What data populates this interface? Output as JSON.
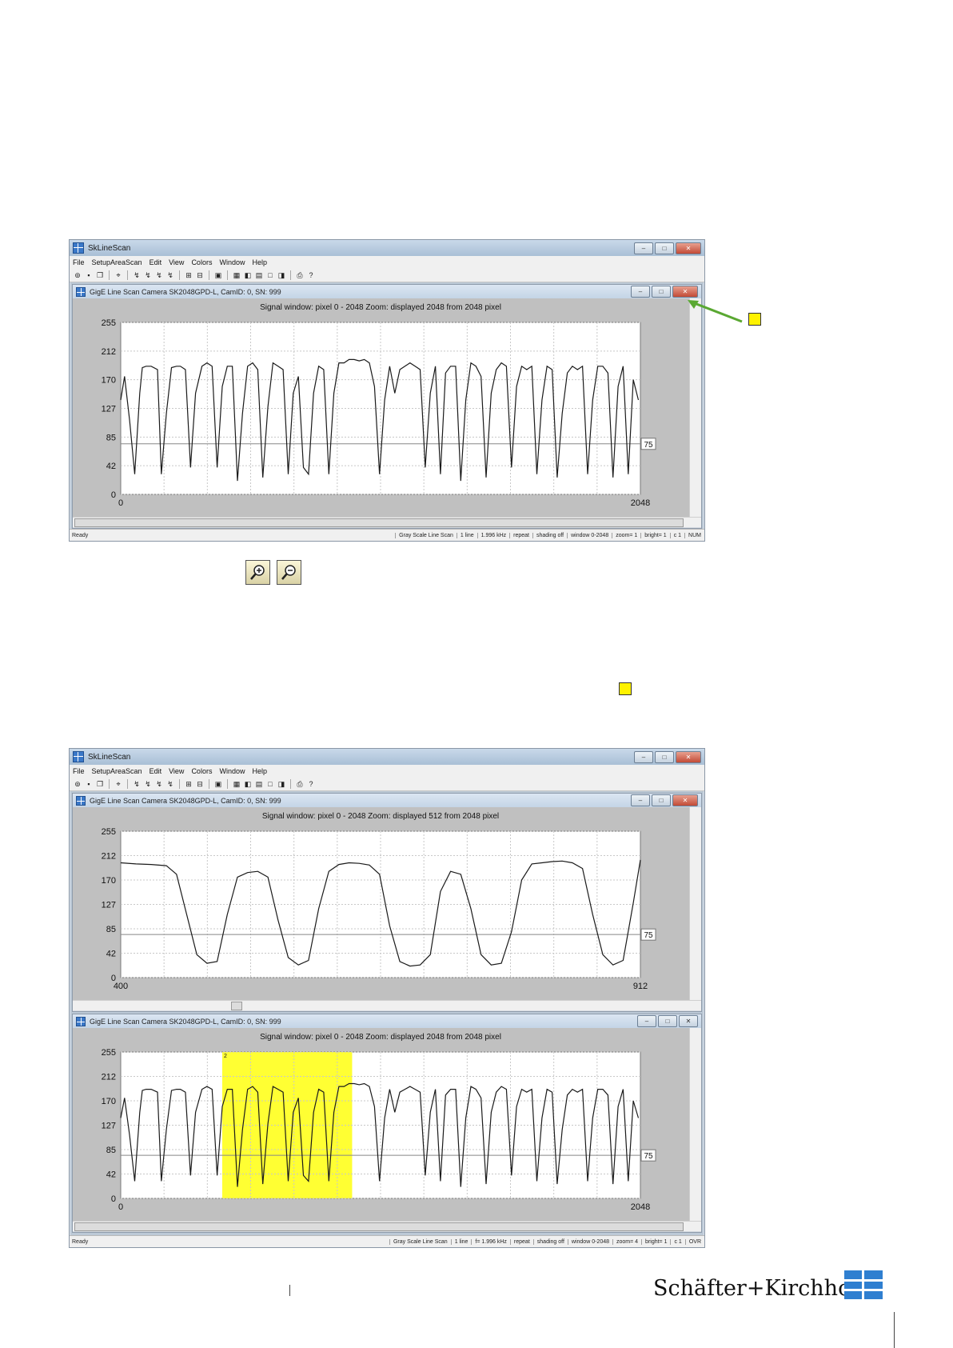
{
  "app_title": "SkLineScan",
  "menu": [
    "File",
    "SetupAreaScan",
    "Edit",
    "View",
    "Colors",
    "Window",
    "Help"
  ],
  "window_buttons": {
    "minimize": "–",
    "restore": "□",
    "close": "✕"
  },
  "camera_window_title": "GigE Line Scan Camera SK2048GPD-L, CamID: 0, SN: 999",
  "signal_windows": {
    "top": {
      "header": "Signal window:  pixel 0 - 2048        Zoom: displayed 2048 from 2048 pixel",
      "x_start": "0",
      "x_end": "2048",
      "y_ticks": [
        "255",
        "212",
        "170",
        "127",
        "85",
        "42",
        "0"
      ],
      "threshold_label": "75"
    },
    "zoomed": {
      "header": "Signal window:  pixel 0 - 2048        Zoom: displayed 512 from 2048 pixel",
      "x_start": "400",
      "x_end": "912",
      "y_ticks": [
        "255",
        "212",
        "170",
        "127",
        "85",
        "42",
        "0"
      ],
      "threshold_label": "75"
    },
    "overview": {
      "header": "Signal window:  pixel 0 - 2048        Zoom: displayed 2048 from 2048 pixel",
      "x_start": "0",
      "x_end": "2048",
      "y_ticks": [
        "255",
        "212",
        "170",
        "127",
        "85",
        "42",
        "0"
      ],
      "threshold_label": "75",
      "selection_label": "2",
      "selection_color": "#ffff33"
    }
  },
  "status_top": {
    "ready": "Ready",
    "cells": [
      "Gray Scale Line Scan",
      "1 line",
      "1.996 kHz",
      "repeat",
      "shading off",
      "window 0-2048",
      "zoom= 1",
      "bright= 1",
      "c 1",
      "NUM"
    ]
  },
  "status_bottom": {
    "ready": "Ready",
    "cells": [
      "Gray Scale Line Scan",
      "1 line",
      "f= 1.996 kHz",
      "repeat",
      "shading off",
      "window 0-2048",
      "zoom= 4",
      "bright= 1",
      "c 1",
      "OVR"
    ]
  },
  "zoom_buttons": [
    "zoom-in",
    "zoom-out"
  ],
  "brand": {
    "name": "Schäfter+Kirchhoff",
    "color": "#2f7fd0"
  },
  "colors": {
    "marker": "#fff200",
    "arrow": "#5aa832",
    "trace": "#1a1a1a"
  },
  "chart_data": [
    {
      "type": "line",
      "x_range": [
        0,
        2048
      ],
      "y_range": [
        0,
        255
      ],
      "threshold": 75,
      "x": [
        0,
        15,
        35,
        55,
        75,
        85,
        100,
        120,
        145,
        160,
        180,
        200,
        220,
        235,
        255,
        275,
        295,
        320,
        340,
        360,
        380,
        400,
        420,
        440,
        460,
        480,
        500,
        520,
        540,
        560,
        580,
        600,
        620,
        640,
        660,
        680,
        700,
        720,
        740,
        760,
        780,
        800,
        820,
        840,
        860,
        880,
        900,
        920,
        940,
        960,
        980,
        1000,
        1020,
        1040,
        1060,
        1080,
        1100,
        1120,
        1140,
        1160,
        1180,
        1200,
        1220,
        1240,
        1260,
        1280,
        1300,
        1320,
        1340,
        1360,
        1380,
        1400,
        1420,
        1440,
        1460,
        1480,
        1500,
        1520,
        1540,
        1560,
        1580,
        1600,
        1620,
        1640,
        1660,
        1680,
        1700,
        1720,
        1740,
        1760,
        1780,
        1800,
        1820,
        1840,
        1860,
        1880,
        1900,
        1920,
        1940,
        1960,
        1980,
        2000,
        2020,
        2040
      ],
      "values": [
        140,
        175,
        110,
        30,
        150,
        188,
        190,
        190,
        185,
        30,
        120,
        188,
        190,
        190,
        185,
        40,
        150,
        190,
        195,
        190,
        40,
        160,
        190,
        190,
        20,
        120,
        190,
        195,
        185,
        25,
        130,
        195,
        190,
        185,
        30,
        150,
        175,
        40,
        30,
        150,
        190,
        185,
        30,
        150,
        195,
        195,
        200,
        200,
        198,
        200,
        195,
        160,
        30,
        140,
        190,
        150,
        185,
        190,
        195,
        190,
        185,
        40,
        150,
        190,
        30,
        180,
        190,
        190,
        20,
        140,
        195,
        190,
        175,
        25,
        150,
        185,
        195,
        190,
        40,
        160,
        190,
        185,
        190,
        30,
        140,
        190,
        185,
        25,
        120,
        180,
        190,
        185,
        190,
        30,
        140,
        190,
        190,
        180,
        25,
        160,
        190,
        30,
        170,
        140
      ]
    },
    {
      "type": "line",
      "x_range": [
        400,
        912
      ],
      "y_range": [
        0,
        255
      ],
      "threshold": 75,
      "x": [
        400,
        415,
        430,
        445,
        455,
        465,
        475,
        485,
        495,
        505,
        515,
        525,
        535,
        545,
        555,
        565,
        575,
        585,
        595,
        605,
        615,
        625,
        635,
        645,
        655,
        665,
        675,
        685,
        695,
        705,
        715,
        725,
        735,
        745,
        755,
        765,
        775,
        785,
        795,
        805,
        815,
        825,
        835,
        845,
        855,
        865,
        875,
        885,
        895,
        905,
        912
      ],
      "values": [
        200,
        198,
        197,
        195,
        180,
        110,
        40,
        25,
        28,
        110,
        175,
        183,
        185,
        175,
        100,
        35,
        22,
        30,
        120,
        185,
        197,
        200,
        199,
        196,
        180,
        90,
        28,
        20,
        22,
        40,
        150,
        185,
        180,
        120,
        40,
        22,
        25,
        80,
        170,
        198,
        200,
        202,
        203,
        200,
        190,
        110,
        40,
        22,
        30,
        130,
        205
      ]
    }
  ]
}
